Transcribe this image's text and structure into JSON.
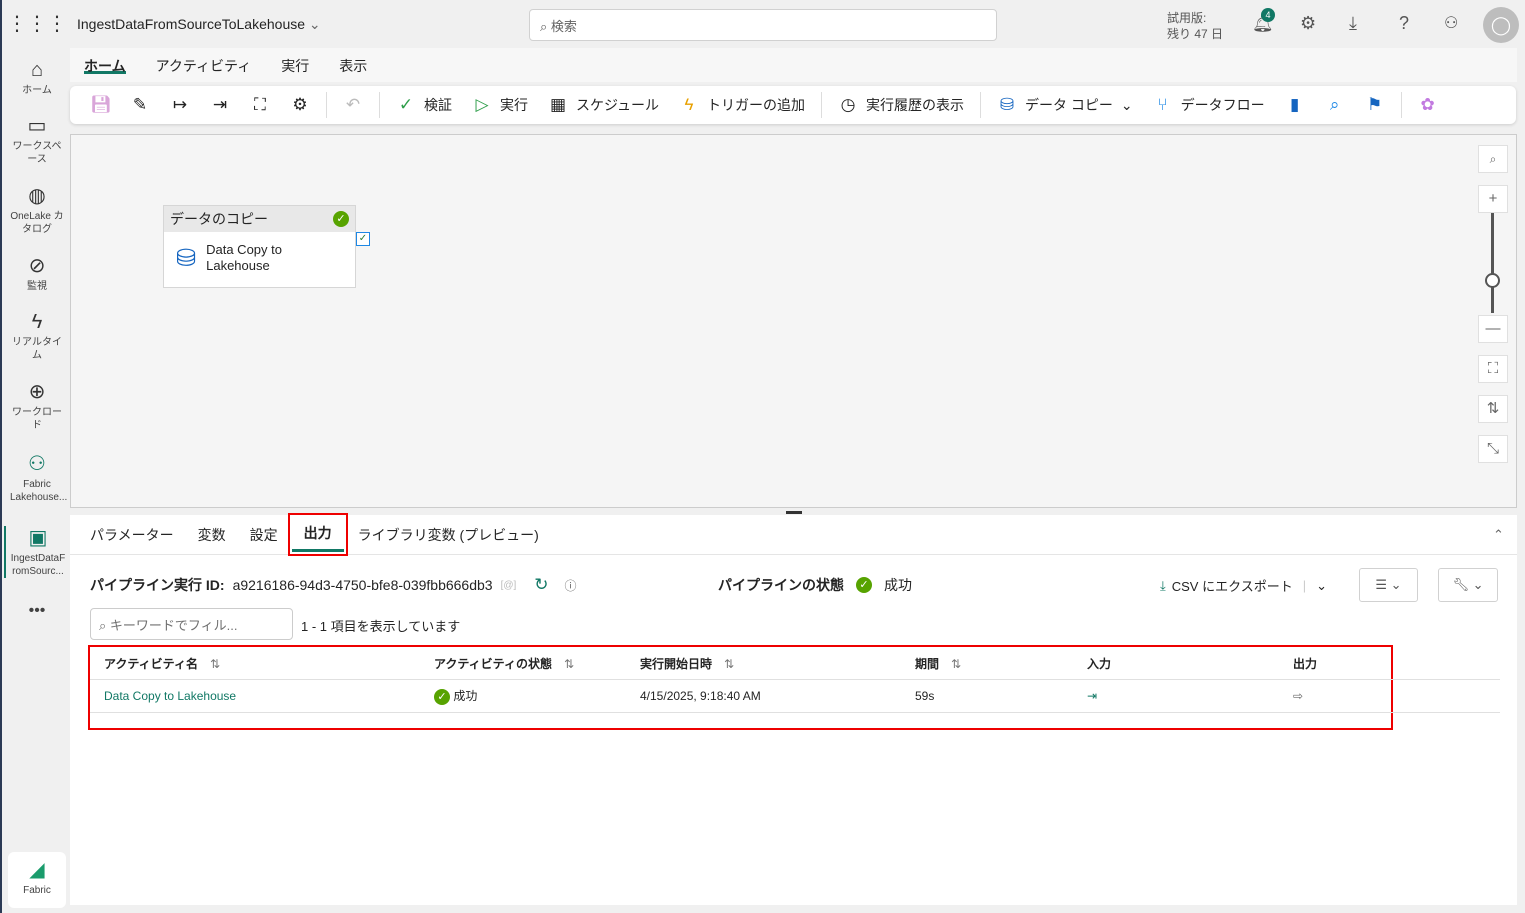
{
  "app": {
    "title": "IngestDataFromSourceToLakehouse",
    "search_placeholder": "検索",
    "trial_line1": "試用版:",
    "trial_line2": "残り 47 日",
    "notif_count": "4"
  },
  "rail": [
    {
      "label": "ホーム",
      "icon": "⌂"
    },
    {
      "label": "ワークスペース",
      "icon": "▭"
    },
    {
      "label": "OneLake カタログ",
      "icon": "◍"
    },
    {
      "label": "監視",
      "icon": "⊘"
    },
    {
      "label": "リアルタイム",
      "icon": "ϟ"
    },
    {
      "label": "ワークロード",
      "icon": "⊕"
    },
    {
      "label": "Fabric Lakehouse...",
      "icon": "⚇"
    },
    {
      "label": "IngestDataFromSourc...",
      "icon": "▣"
    }
  ],
  "fabric_label": "Fabric",
  "ribbon_tabs": [
    "ホーム",
    "アクティビティ",
    "実行",
    "表示"
  ],
  "toolbar": {
    "validate": "検証",
    "run": "実行",
    "schedule": "スケジュール",
    "trigger": "トリガーの追加",
    "history": "実行履歴の表示",
    "copy": "データ コピー",
    "dataflow": "データフロー"
  },
  "node": {
    "header": "データのコピー",
    "name": "Data Copy to Lakehouse"
  },
  "panel": {
    "tabs": [
      "パラメーター",
      "変数",
      "設定",
      "出力",
      "ライブラリ変数 (プレビュー)"
    ],
    "run_id_label": "パイプライン実行 ID:",
    "run_id": "a9216186-94d3-4750-bfe8-039fbb666db3",
    "status_label": "パイプラインの状態",
    "status": "成功",
    "export": "CSV にエクスポート",
    "filter_placeholder": "キーワードでフィル...",
    "count_text": "1 - 1 項目を表示しています",
    "columns": [
      "アクティビティ名",
      "アクティビティの状態",
      "実行開始日時",
      "期間",
      "入力",
      "出力"
    ],
    "rows": [
      {
        "name": "Data Copy to Lakehouse",
        "status": "成功",
        "start": "4/15/2025, 9:18:40 AM",
        "duration": "59s"
      }
    ]
  },
  "colors": {
    "accent": "#117865",
    "success": "#57a300",
    "highlight": "#ee0000"
  }
}
